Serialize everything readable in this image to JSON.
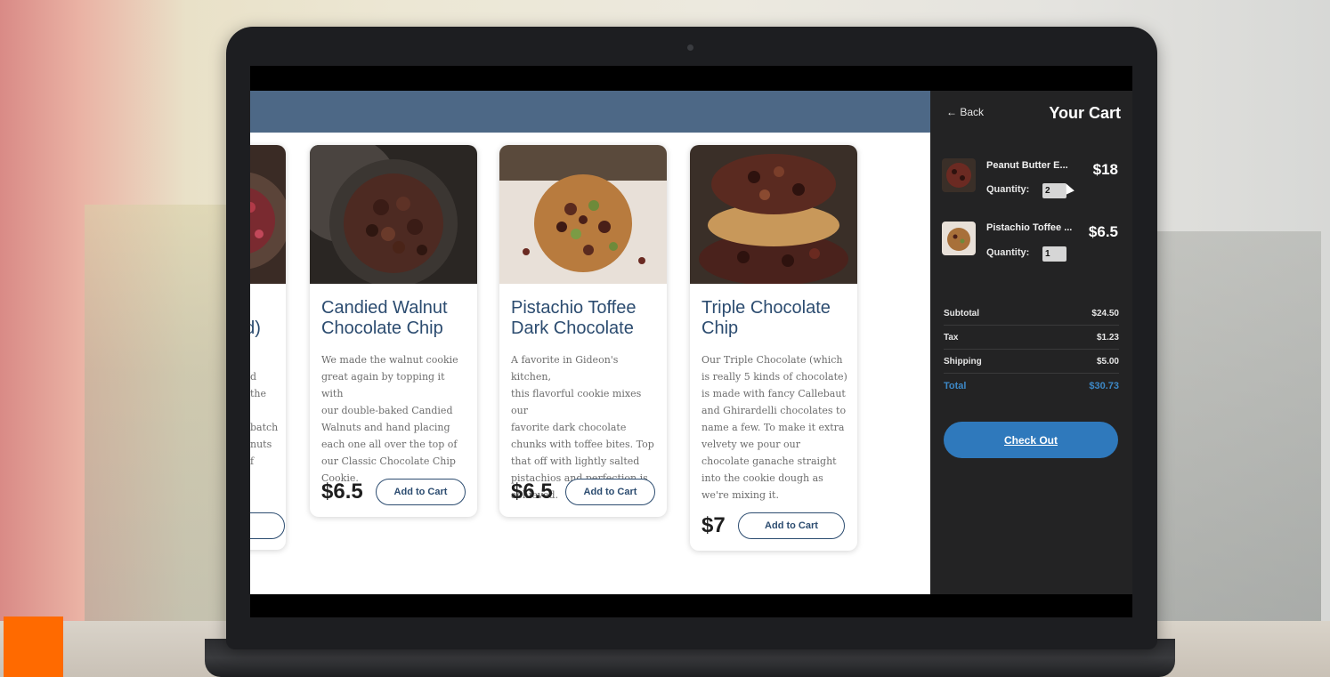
{
  "products": [
    {
      "title_lines": [
        "",
        "ed)"
      ],
      "desc_lines": [
        "",
        "d",
        "the",
        "",
        "batch",
        "nuts",
        "f",
        ""
      ],
      "price": "",
      "add_label": ""
    },
    {
      "title_lines": [
        "Candied Walnut",
        "Chocolate Chip"
      ],
      "desc_lines": [
        "We made the walnut cookie",
        "great again by topping it with",
        "our double-baked Candied",
        "Walnuts and hand placing",
        "each one all over the top of",
        "our Classic Chocolate Chip",
        "Cookie."
      ],
      "price": "$6.5",
      "add_label": "Add to Cart"
    },
    {
      "title_lines": [
        "Pistachio Toffee",
        "Dark Chocolate"
      ],
      "desc_lines": [
        "A favorite in Gideon's kitchen,",
        "this flavorful cookie mixes our",
        "favorite dark chocolate",
        "chunks with toffee bites. Top",
        "that off with lightly salted",
        "pistachios and perfection is",
        "achieved."
      ],
      "price": "$6.5",
      "add_label": "Add to Cart"
    },
    {
      "title_lines": [
        "Triple Chocolate",
        "Chip"
      ],
      "desc_lines": [
        "Our Triple Chocolate (which",
        "is really 5 kinds of chocolate)",
        "is made with fancy Callebaut",
        "and Ghirardelli chocolates to",
        "name a few. To make it extra",
        "velvety we pour our",
        "chocolate ganache straight",
        "into the cookie dough as",
        "we're mixing it."
      ],
      "price": "$7",
      "add_label": "Add to Cart"
    }
  ],
  "cart": {
    "back_label": "← Back",
    "title": "Your Cart",
    "items": [
      {
        "name": "Peanut Butter E...",
        "price": "$18",
        "quantity_label": "Quantity:",
        "quantity": "2"
      },
      {
        "name": "Pistachio Toffee ...",
        "price": "$6.5",
        "quantity_label": "Quantity:",
        "quantity": "1"
      }
    ],
    "summary": {
      "subtotal_label": "Subtotal",
      "subtotal": "$24.50",
      "tax_label": "Tax",
      "tax": "$1.23",
      "shipping_label": "Shipping",
      "shipping": "$5.00",
      "total_label": "Total",
      "total": "$30.73"
    },
    "checkout_label": "Check Out"
  },
  "colors": {
    "header": "#4d6886",
    "title_blue": "#2c4c70",
    "cart_bg": "#232324",
    "checkout_blue": "#2f79bc",
    "total_blue": "#3d88c6",
    "badge_orange": "#ff6a00"
  }
}
